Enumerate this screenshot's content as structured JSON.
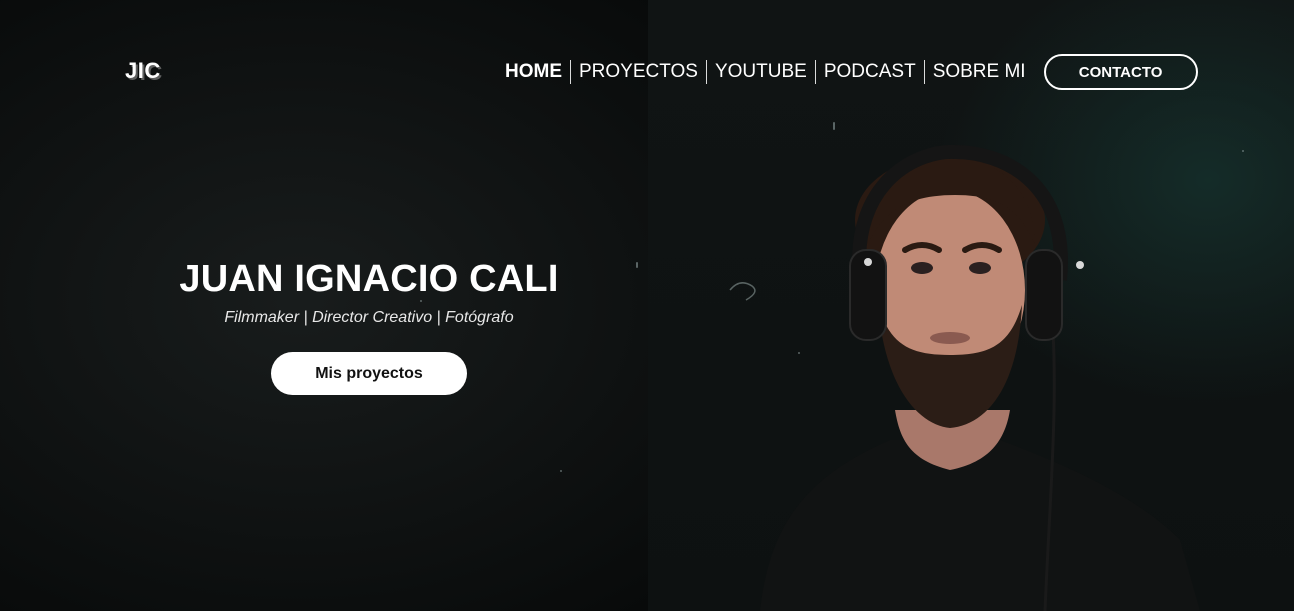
{
  "logo": {
    "text": "JIC"
  },
  "nav": {
    "items": [
      {
        "label": "HOME",
        "active": true
      },
      {
        "label": "PROYECTOS",
        "active": false
      },
      {
        "label": "YOUTUBE",
        "active": false
      },
      {
        "label": "PODCAST",
        "active": false
      },
      {
        "label": "SOBRE MI",
        "active": false
      }
    ],
    "contact_label": "CONTACTO"
  },
  "hero": {
    "title": "JUAN IGNACIO CALI",
    "subtitle": "Filmmaker | Director Creativo | Fotógrafo",
    "cta_label": "Mis proyectos"
  },
  "colors": {
    "background": "#0a0c0c",
    "accent_glow": "#19403a",
    "text": "#ffffff",
    "button_bg": "#ffffff"
  },
  "icons": [
    "portrait-photo"
  ]
}
